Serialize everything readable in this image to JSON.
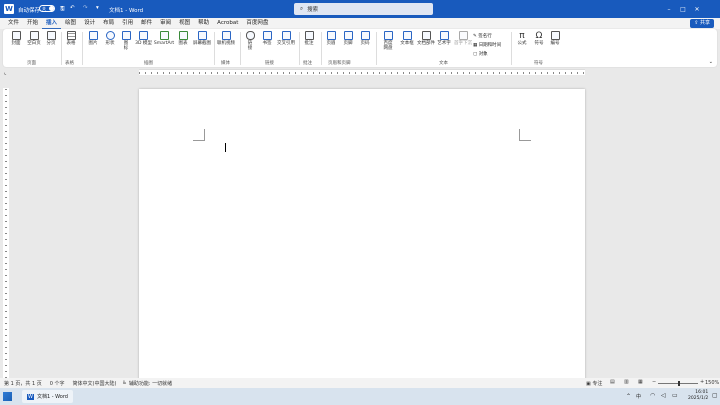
{
  "titlebar": {
    "autosave_label": "自动保存",
    "autosave_state": "关",
    "doc_title": "文档1 - Word",
    "search_placeholder": "搜索"
  },
  "menu": {
    "tabs": [
      "文件",
      "开始",
      "插入",
      "绘图",
      "设计",
      "布局",
      "引用",
      "邮件",
      "审阅",
      "视图",
      "帮助",
      "Acrobat",
      "百度网盘"
    ],
    "active_tab": "插入",
    "share_label": "共享"
  },
  "ribbon": {
    "buttons": {
      "cover": "封面",
      "blank_page": "空白页",
      "page_break": "分页",
      "table": "表格",
      "picture": "图片",
      "shapes": "形状",
      "icons": "图标",
      "model3d": "3D 模型",
      "smartart": "SmartArt",
      "chart": "图表",
      "screenshot": "屏幕截图",
      "online_video": "联机视频",
      "link": "链接",
      "bookmark": "书签",
      "cross_ref": "交叉引用",
      "comment": "批注",
      "header": "页眉",
      "footer": "页脚",
      "page_number": "页码",
      "baidu_netdisk": "百度网盘",
      "textbox": "文本框",
      "doc_parts": "文档部件",
      "wordart": "艺术字",
      "drop_cap": "首字下沉",
      "signature_line": "签名行",
      "date_time": "日期和时间",
      "object": "对象",
      "equation": "公式",
      "symbol": "符号",
      "numbering": "编号"
    },
    "groups": {
      "pages": "页面",
      "tables": "表格",
      "illustrations": "插图",
      "media": "媒体",
      "links": "链接",
      "comments": "批注",
      "header_footer": "页眉和页脚",
      "text": "文本",
      "symbols": "符号"
    }
  },
  "status": {
    "page": "第 1 页，共 1 页",
    "words": "0 个字",
    "language": "简体中文(中国大陆)",
    "accessibility": "辅助功能: 一切就绪",
    "focus": "专注",
    "zoom": "150%"
  },
  "taskbar": {
    "app_label": "文档1 - Word",
    "time": "16:01",
    "date": "2025/1/2"
  },
  "colors": {
    "brand": "#185abd",
    "ribbon_bg": "#ffffff",
    "canvas_bg": "#e9e9e9"
  }
}
